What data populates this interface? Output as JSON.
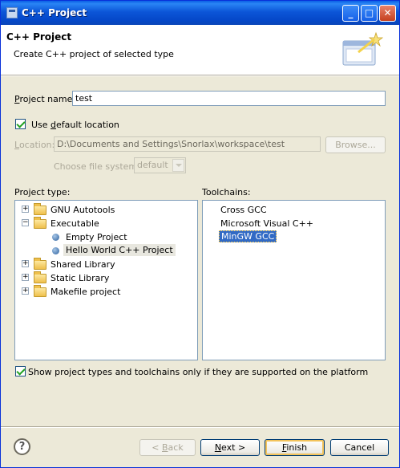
{
  "window": {
    "title": "C++ Project",
    "controls": {
      "minimize": "_",
      "maximize": "□",
      "close": "✕"
    }
  },
  "header": {
    "title": "C++ Project",
    "description": "Create C++ project of selected type",
    "banner_icon": "new-project-wizard-icon"
  },
  "project_name": {
    "label_mnemonic": "P",
    "label_rest": "roject name:",
    "value": "test"
  },
  "use_default_location": {
    "label_pre": "Use ",
    "label_mnemonic": "d",
    "label_rest": "efault location",
    "checked": true
  },
  "location": {
    "label_mnemonic": "L",
    "label_rest": "ocation:",
    "value": "D:\\Documents and Settings\\Snorlax\\workspace\\test",
    "browse_label": "Browse..."
  },
  "file_system": {
    "label": "Choose file system:",
    "value": "default"
  },
  "project_type": {
    "label": "Project type:",
    "items": [
      {
        "label": "GNU Autotools",
        "expander": "+",
        "kind": "folder"
      },
      {
        "label": "Executable",
        "expander": "−",
        "kind": "folder"
      },
      {
        "label": "Empty Project",
        "kind": "template"
      },
      {
        "label": "Hello World C++ Project",
        "kind": "template",
        "selected": true
      },
      {
        "label": "Shared Library",
        "expander": "+",
        "kind": "folder"
      },
      {
        "label": "Static Library",
        "expander": "+",
        "kind": "folder"
      },
      {
        "label": "Makefile project",
        "expander": "+",
        "kind": "folder"
      }
    ]
  },
  "toolchains": {
    "label": "Toolchains:",
    "items": [
      {
        "label": "Cross GCC"
      },
      {
        "label": "Microsoft Visual C++"
      },
      {
        "label": "MinGW GCC",
        "selected": true
      }
    ]
  },
  "show_supported": {
    "label": "Show project types and toolchains only if they are supported on the platform",
    "checked": true
  },
  "buttons": {
    "help": "?",
    "back_pre": "< ",
    "back_mnemonic": "B",
    "back_rest": "ack",
    "next_mnemonic": "N",
    "next_rest": "ext >",
    "finish_mnemonic": "F",
    "finish_rest": "inish",
    "cancel": "Cancel"
  }
}
